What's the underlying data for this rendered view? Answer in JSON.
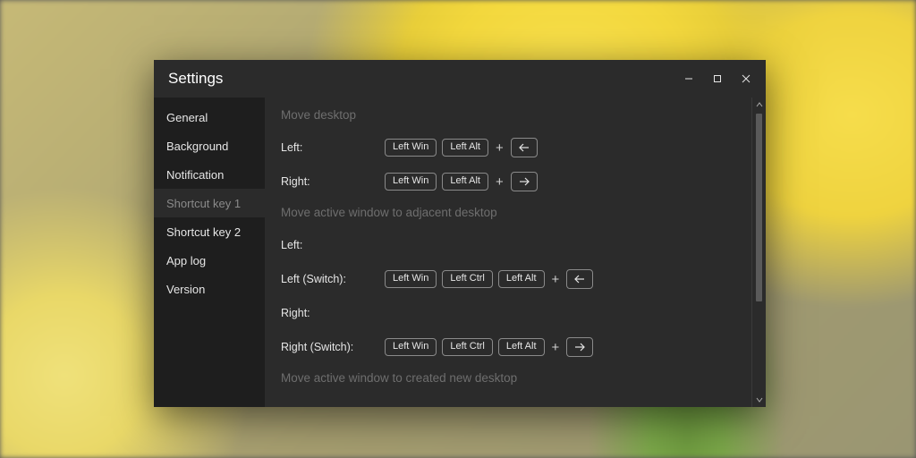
{
  "window": {
    "title": "Settings"
  },
  "sidebar": {
    "items": [
      {
        "label": "General"
      },
      {
        "label": "Background"
      },
      {
        "label": "Notification"
      },
      {
        "label": "Shortcut key 1"
      },
      {
        "label": "Shortcut key 2"
      },
      {
        "label": "App log"
      },
      {
        "label": "Version"
      }
    ],
    "active_index": 3
  },
  "sections": {
    "move_desktop": {
      "heading": "Move desktop",
      "left": {
        "label": "Left:",
        "mods": [
          "Left Win",
          "Left Alt"
        ],
        "arrow": "left"
      },
      "right": {
        "label": "Right:",
        "mods": [
          "Left Win",
          "Left Alt"
        ],
        "arrow": "right"
      }
    },
    "move_active_adjacent": {
      "heading": "Move active window to adjacent desktop",
      "left": {
        "label": "Left:"
      },
      "left_switch": {
        "label": "Left (Switch):",
        "mods": [
          "Left Win",
          "Left Ctrl",
          "Left Alt"
        ],
        "arrow": "left"
      },
      "right": {
        "label": "Right:"
      },
      "right_switch": {
        "label": "Right (Switch):",
        "mods": [
          "Left Win",
          "Left Ctrl",
          "Left Alt"
        ],
        "arrow": "right"
      }
    },
    "move_active_new": {
      "heading": "Move active window to created new desktop"
    }
  },
  "glyphs": {
    "plus": "+"
  }
}
